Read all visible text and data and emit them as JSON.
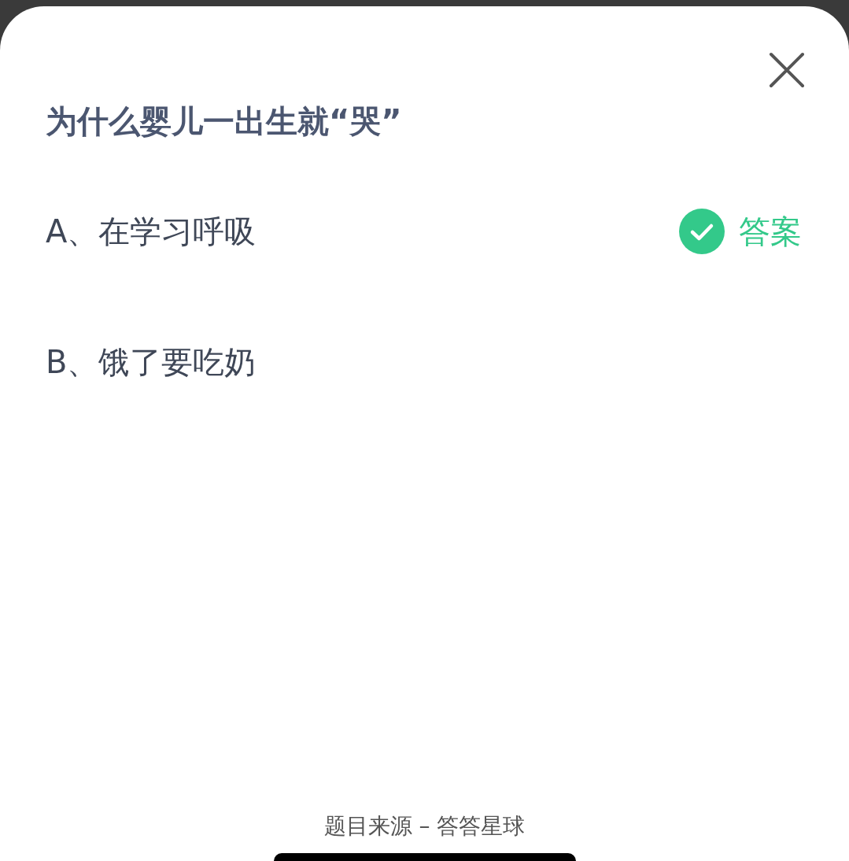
{
  "title": "为什么婴儿一出生就“哭”",
  "options": [
    {
      "label": "A、在学习呼吸",
      "correct": true
    },
    {
      "label": "B、饿了要吃奶",
      "correct": false
    }
  ],
  "answer_label": "答案",
  "source": "题目来源 – 答答星球"
}
